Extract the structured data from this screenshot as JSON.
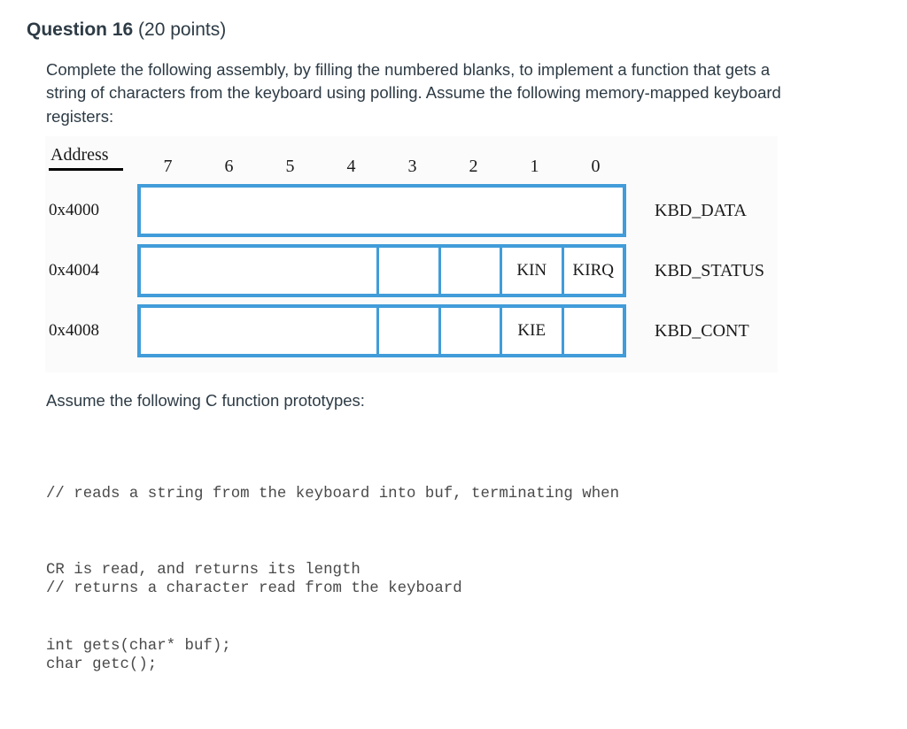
{
  "question": {
    "title": "Question 16",
    "points": "(20 points)",
    "prompt": "Complete the following assembly, by filling the numbered blanks, to implement a function that gets a string of characters from the keyboard using polling. Assume the following memory-mapped keyboard registers:"
  },
  "figure": {
    "address_header": "Address",
    "bit_labels": [
      "7",
      "6",
      "5",
      "4",
      "3",
      "2",
      "1",
      "0"
    ],
    "rows": [
      {
        "address": "0x4000",
        "register_name": "KBD_DATA",
        "cells": [
          {
            "span": 8,
            "label": ""
          }
        ]
      },
      {
        "address": "0x4004",
        "register_name": "KBD_STATUS",
        "cells": [
          {
            "span": 4,
            "label": ""
          },
          {
            "span": 1,
            "label": ""
          },
          {
            "span": 1,
            "label": ""
          },
          {
            "span": 1,
            "label": "KIN"
          },
          {
            "span": 1,
            "label": "KIRQ"
          }
        ]
      },
      {
        "address": "0x4008",
        "register_name": "KBD_CONT",
        "cells": [
          {
            "span": 4,
            "label": ""
          },
          {
            "span": 1,
            "label": ""
          },
          {
            "span": 1,
            "label": ""
          },
          {
            "span": 1,
            "label": "KIE"
          },
          {
            "span": 1,
            "label": ""
          }
        ]
      }
    ],
    "border_color": "#419cd9",
    "background_color": "#fbfbfb"
  },
  "prototypes": {
    "lead_in": "Assume the following C function prototypes:",
    "block1": [
      "// reads a string from the keyboard into buf, terminating when",
      "CR is read, and returns its length",
      "int gets(char* buf);"
    ],
    "block2": [
      "// returns a character read from the keyboard",
      "char getc();"
    ]
  }
}
